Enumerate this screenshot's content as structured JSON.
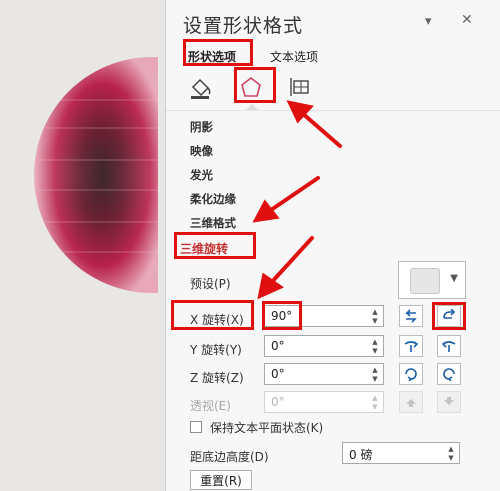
{
  "panel": {
    "title": "设置形状格式",
    "tabs": [
      {
        "label": "形状选项",
        "selected": true
      },
      {
        "label": "文本选项",
        "selected": false
      }
    ],
    "icon_tabs": [
      "fill-line-icon",
      "effects-pentagon-icon",
      "size-properties-icon"
    ],
    "categories": [
      "阴影",
      "映像",
      "发光",
      "柔化边缘",
      "三维格式",
      "三维旋转"
    ],
    "active_category": "三维旋转",
    "preset_label": "预设(P)",
    "rotation": [
      {
        "label": "X 旋转(X)",
        "value": "90°",
        "enabled": true
      },
      {
        "label": "Y 旋转(Y)",
        "value": "0°",
        "enabled": true
      },
      {
        "label": "Z 旋转(Z)",
        "value": "0°",
        "enabled": true
      },
      {
        "label": "透视(E)",
        "value": "0°",
        "enabled": false
      }
    ],
    "keep_text_flat_label": "保持文本平面状态(K)",
    "distance_label": "距底边高度(D)",
    "distance_value": "0 磅",
    "reset_label": "重置(R)"
  },
  "colors": {
    "highlight": "#e01010",
    "sphere_dark": "#2a0610",
    "sphere_mid": "#b01640"
  }
}
